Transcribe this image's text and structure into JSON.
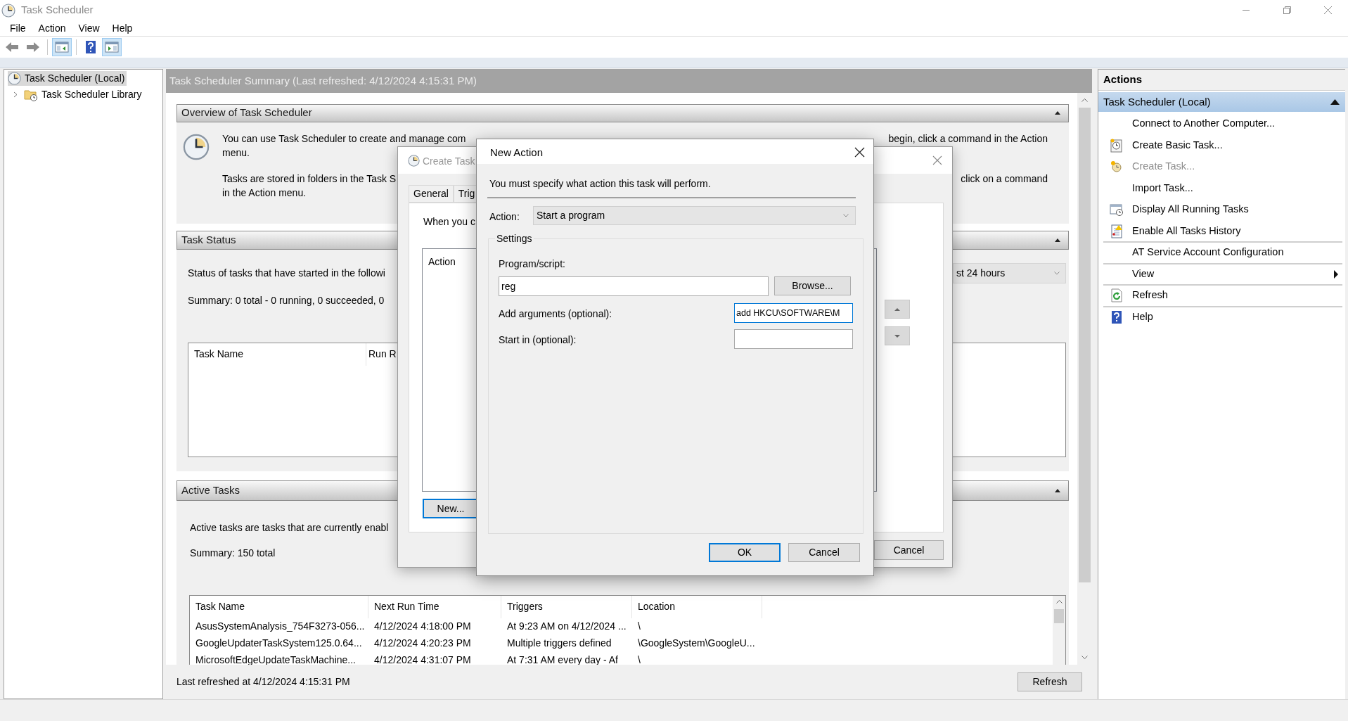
{
  "window": {
    "title": "Task Scheduler"
  },
  "menu": [
    {
      "label": "File"
    },
    {
      "label": "Action"
    },
    {
      "label": "View"
    },
    {
      "label": "Help"
    }
  ],
  "toolbar": [
    {
      "kind": "back",
      "pressed": false
    },
    {
      "kind": "forward",
      "pressed": false
    },
    {
      "kind": "console_tree",
      "pressed": true
    },
    {
      "kind": "help",
      "pressed": false
    },
    {
      "kind": "action_pane",
      "pressed": true
    }
  ],
  "tree": [
    {
      "label": "Task Scheduler (Local)",
      "selected": true,
      "children": [
        {
          "label": "Task Scheduler Library",
          "selected": false,
          "expanded": false
        }
      ]
    }
  ],
  "summary": {
    "title": "Task Scheduler Summary (Last refreshed: 4/12/2024 4:15:31 PM)",
    "overview": {
      "title": "Overview of Task Scheduler",
      "paragraphs": [
        [
          {
            "left": "You can use Task Scheduler to create and manage com",
            "right": "begin, click a command in the Action"
          },
          {
            "left": "menu."
          }
        ],
        [
          {
            "left": "Tasks are stored in folders in the Task S",
            "right": "click on a command"
          },
          {
            "left": "in the Action menu."
          }
        ]
      ]
    },
    "task_status": {
      "title": "Task Status",
      "description": "Status of tasks that have started in the followi",
      "period": "st 24 hours",
      "summary": "Summary: 0 total - 0 running, 0 succeeded, 0",
      "columns": [
        "Task Name",
        "Run R"
      ]
    },
    "active_tasks": {
      "title": "Active Tasks",
      "description": "Active tasks are tasks that are currently enabl",
      "summary": "Summary: 150 total",
      "columns": [
        "Task Name",
        "Next Run Time",
        "Triggers",
        "Location"
      ],
      "rows": [
        [
          "AsusSystemAnalysis_754F3273-056...",
          "4/12/2024 4:18:00 PM",
          "At 9:23 AM on 4/12/2024 ...",
          "\\"
        ],
        [
          "GoogleUpdaterTaskSystem125.0.64...",
          "4/12/2024 4:20:23 PM",
          "Multiple triggers defined",
          "\\GoogleSystem\\GoogleU..."
        ],
        [
          "MicrosoftEdgeUpdateTaskMachine...",
          "4/12/2024 4:31:07 PM",
          "At 7:31 AM every day - Af",
          "\\"
        ]
      ]
    },
    "footer": {
      "text": "Last refreshed at 4/12/2024 4:15:31 PM",
      "button": "Refresh"
    }
  },
  "actions_pane": {
    "title": "Actions",
    "group": {
      "label": "Task Scheduler (Local)",
      "expanded": true
    },
    "items": [
      {
        "label": "Connect to Another Computer...",
        "kind": "plain",
        "disabled": false,
        "submenu": false,
        "divider_below": false
      },
      {
        "label": "Create Basic Task...",
        "kind": "basic_task",
        "disabled": false,
        "submenu": false,
        "divider_below": false
      },
      {
        "label": "Create Task...",
        "kind": "new_task",
        "disabled": true,
        "submenu": false,
        "divider_below": false
      },
      {
        "label": "Import Task...",
        "kind": "plain",
        "disabled": false,
        "submenu": false,
        "divider_below": false
      },
      {
        "label": "Display All Running Tasks",
        "kind": "running",
        "disabled": false,
        "submenu": false,
        "divider_below": false
      },
      {
        "label": "Enable All Tasks History",
        "kind": "history",
        "disabled": false,
        "submenu": false,
        "divider_below": true
      },
      {
        "label": "AT Service Account Configuration",
        "kind": "plain",
        "disabled": false,
        "submenu": false,
        "divider_below": true
      },
      {
        "label": "View",
        "kind": "plain",
        "disabled": false,
        "submenu": true,
        "divider_below": true
      },
      {
        "label": "Refresh",
        "kind": "refresh",
        "disabled": false,
        "submenu": false,
        "divider_below": true
      },
      {
        "label": "Help",
        "kind": "help",
        "disabled": false,
        "submenu": false,
        "divider_below": false
      }
    ]
  },
  "create_task_dialog": {
    "title": "Create Task",
    "tabs": [
      {
        "label": "General",
        "selected": false
      },
      {
        "label": "Trig",
        "selected": false
      }
    ],
    "intro": "When you c",
    "list_column": "Action",
    "new_button": "New...",
    "cancel_button": "Cancel"
  },
  "new_action_dialog": {
    "title": "New Action",
    "instruction": "You must specify what action this task will perform.",
    "action_label": "Action:",
    "action_value": "Start a program",
    "settings_title": "Settings",
    "fields": [
      {
        "kind": "wide",
        "label": "Program/script:",
        "value": "reg",
        "focused": false
      },
      {
        "kind": "inline",
        "label": "Add arguments (optional):",
        "value": "add HKCU\\SOFTWARE\\M",
        "focused": true
      },
      {
        "kind": "inline",
        "label": "Start in (optional):",
        "focused": false
      }
    ],
    "browse_button": "Browse...",
    "ok_button": "OK",
    "cancel_button": "Cancel"
  }
}
